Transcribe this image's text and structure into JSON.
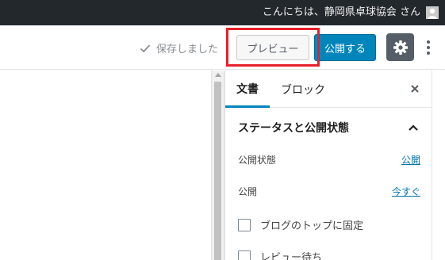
{
  "admin_bar": {
    "greeting": "こんにちは、静岡県卓球協会 さん",
    "avatar_icon": "user-avatar-icon"
  },
  "header": {
    "saved_status": "保存しました",
    "saved_icon": "check-icon",
    "preview_label": "プレビュー",
    "publish_label": "公開する",
    "settings_icon": "gear-icon",
    "more_icon": "vertical-ellipsis-icon",
    "accent_color": "#0085ba",
    "highlight_color": "#e8202a"
  },
  "sidebar": {
    "tabs": [
      {
        "label": "文書",
        "active": true
      },
      {
        "label": "ブロック",
        "active": false
      }
    ],
    "close_icon": "close-icon",
    "panel": {
      "title": "ステータスと公開状態",
      "expanded": true,
      "rows": [
        {
          "label": "公開状態",
          "value": "公開"
        },
        {
          "label": "公開",
          "value": "今すぐ"
        }
      ],
      "checkboxes": [
        {
          "label": "ブログのトップに固定",
          "checked": false
        },
        {
          "label": "レビュー待ち",
          "checked": false
        }
      ]
    }
  }
}
